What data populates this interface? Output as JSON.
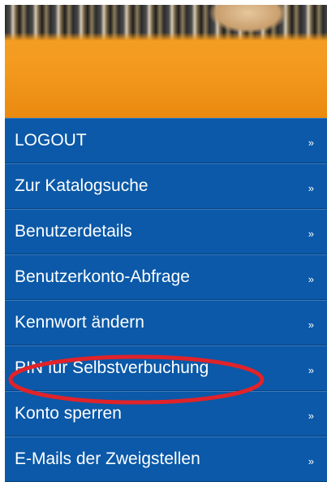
{
  "menu": {
    "items": [
      {
        "label": "LOGOUT",
        "arrow": "»"
      },
      {
        "label": "Zur Katalogsuche",
        "arrow": "»"
      },
      {
        "label": "Benutzerdetails",
        "arrow": "»"
      },
      {
        "label": "Benutzerkonto-Abfrage",
        "arrow": "»"
      },
      {
        "label": "Kennwort ändern",
        "arrow": "»"
      },
      {
        "label": "PIN für Selbstverbuchung",
        "arrow": "»"
      },
      {
        "label": "Konto sperren",
        "arrow": "»"
      },
      {
        "label": "E-Mails der Zweigstellen",
        "arrow": "»"
      }
    ]
  },
  "colors": {
    "menu_background": "#0b59a8",
    "banner_orange": "#f39a1e",
    "highlight_circle": "#e0232a"
  },
  "highlighted_item": "PIN für Selbstverbuchung"
}
